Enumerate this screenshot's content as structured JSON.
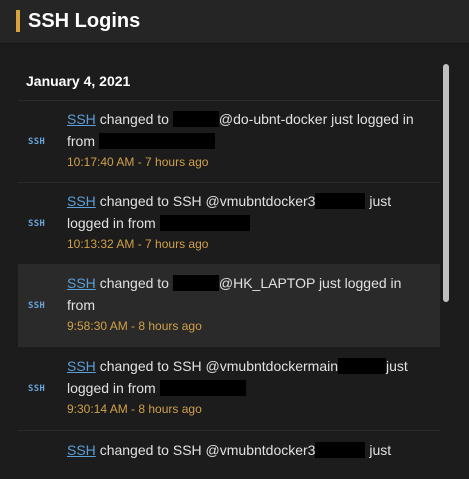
{
  "header": {
    "title": "SSH Logins"
  },
  "date_heading": "January 4, 2021",
  "icon_text": "SSH",
  "entries": [
    {
      "link": "SSH",
      "changed": "changed to",
      "host_line": "@do-ubnt-docker just logged in",
      "from": "from",
      "time": "10:17:40 AM - 7 hours ago"
    },
    {
      "link": "SSH",
      "changed": "changed to SSH @vmubntdocker3",
      "tail": "just",
      "line2": "logged in from",
      "time": "10:13:32 AM - 7 hours ago"
    },
    {
      "link": "SSH",
      "changed": "changed to",
      "host_line": "@HK_LAPTOP just logged in",
      "from": "from",
      "time": "9:58:30 AM - 8 hours ago"
    },
    {
      "link": "SSH",
      "changed": "changed to SSH @vmubntdockermain",
      "tail": "just",
      "line2": "logged in from",
      "time": "9:30:14 AM - 8 hours ago"
    },
    {
      "link": "SSH",
      "changed": "changed to SSH @vmubntdocker3",
      "tail": "just"
    }
  ],
  "colors": {
    "accent": "#d7a33f",
    "link": "#5c9ed6",
    "timestamp": "#d0a046"
  }
}
